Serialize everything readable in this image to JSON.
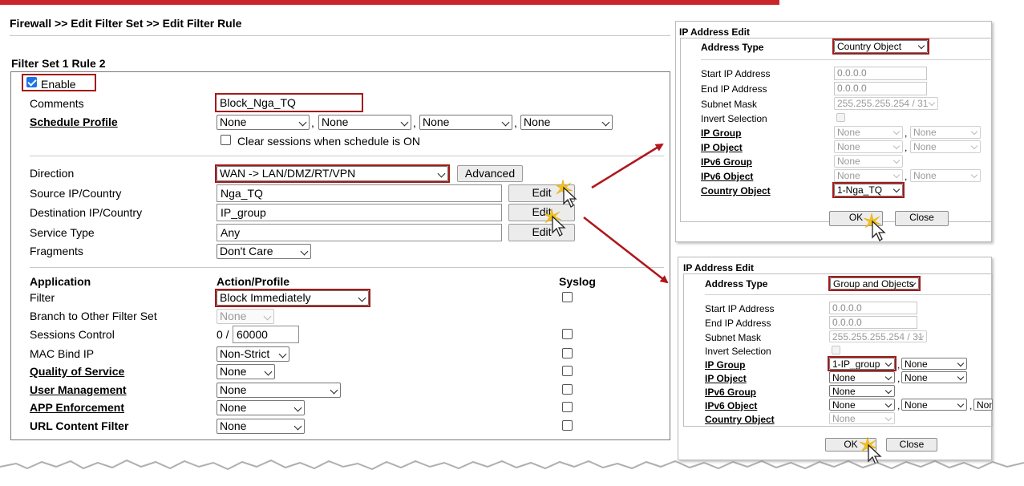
{
  "breadcrumb": "Firewall >> Edit Filter Set >> Edit Filter Rule",
  "section_title": "Filter Set 1 Rule 2",
  "enable": {
    "label": "Enable",
    "checked": true
  },
  "comments": {
    "label": "Comments",
    "value": "Block_Nga_TQ"
  },
  "schedule": {
    "label": "Schedule Profile",
    "options": [
      "None",
      "None",
      "None",
      "None"
    ],
    "clear_sessions_label": "Clear sessions when schedule is ON"
  },
  "direction": {
    "label": "Direction",
    "value": "WAN -> LAN/DMZ/RT/VPN",
    "advanced_label": "Advanced"
  },
  "source": {
    "label": "Source IP/Country",
    "value": "Nga_TQ",
    "edit_label": "Edit"
  },
  "destination": {
    "label": "Destination IP/Country",
    "value": "IP_group",
    "edit_label": "Edit"
  },
  "service": {
    "label": "Service Type",
    "value": "Any",
    "edit_label": "Edit"
  },
  "fragments": {
    "label": "Fragments",
    "value": "Don't Care"
  },
  "table_headers": {
    "application": "Application",
    "action": "Action/Profile",
    "syslog": "Syslog"
  },
  "rows": {
    "filter": {
      "label": "Filter",
      "value": "Block Immediately"
    },
    "branch": {
      "label": "Branch to Other Filter Set",
      "value": "None"
    },
    "sessions": {
      "label": "Sessions Control",
      "prefix": "0 /",
      "value": "60000"
    },
    "macbind": {
      "label": "MAC Bind IP",
      "value": "Non-Strict"
    },
    "qos": {
      "label": "Quality of Service",
      "value": "None"
    },
    "user": {
      "label": "User Management",
      "value": "None"
    },
    "app": {
      "label": "APP Enforcement",
      "value": "None"
    },
    "url": {
      "label": "URL Content Filter",
      "value": "None"
    }
  },
  "panel1": {
    "title": "IP Address Edit",
    "address_type_label": "Address Type",
    "address_type": "Country Object",
    "start_ip_label": "Start IP Address",
    "start_ip": "0.0.0.0",
    "end_ip_label": "End IP Address",
    "end_ip": "0.0.0.0",
    "subnet_label": "Subnet Mask",
    "subnet": "255.255.255.254 / 31",
    "invert_label": "Invert Selection",
    "ip_group_label": "IP Group",
    "ip_object_label": "IP Object",
    "ipv6_group_label": "IPv6 Group",
    "ipv6_object_label": "IPv6 Object",
    "country_label": "Country Object",
    "country_value": "1-Nga_TQ",
    "none": "None",
    "ok_label": "OK",
    "close_label": "Close"
  },
  "panel2": {
    "title": "IP Address Edit",
    "address_type_label": "Address Type",
    "address_type": "Group and Objects",
    "start_ip_label": "Start IP Address",
    "start_ip": "0.0.0.0",
    "end_ip_label": "End IP Address",
    "end_ip": "0.0.0.0",
    "subnet_label": "Subnet Mask",
    "subnet": "255.255.255.254 / 31",
    "invert_label": "Invert Selection",
    "ip_group_label": "IP Group",
    "ip_group_value": "1-IP_group",
    "ip_object_label": "IP Object",
    "ipv6_group_label": "IPv6 Group",
    "ipv6_object_label": "IPv6 Object",
    "country_label": "Country Object",
    "none": "None",
    "none_trunc": "Non",
    "ok_label": "OK",
    "close_label": "Close"
  },
  "colors": {
    "highlight": "#a31b1b",
    "brand_bar": "#c8262a",
    "arrow": "#b0161b"
  },
  "icons": [
    "mouse-cursor-icon",
    "click-burst-icon",
    "arrow-icon"
  ]
}
